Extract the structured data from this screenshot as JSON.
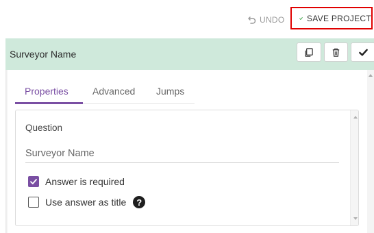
{
  "toolbar": {
    "undo_label": "UNDO",
    "save_label": "SAVE PROJECT",
    "save_highlight_color": "#e00000",
    "save_icon_color": "#2e9e3a"
  },
  "header": {
    "title": "Surveyor Name",
    "background_color": "#cfe9db",
    "actions": [
      "copy-icon",
      "trash-icon",
      "checkmark-icon"
    ]
  },
  "tabs": [
    {
      "label": "Properties",
      "active": true
    },
    {
      "label": "Advanced",
      "active": false
    },
    {
      "label": "Jumps",
      "active": false
    }
  ],
  "accent_color": "#7a4fa3",
  "question": {
    "label": "Question",
    "value": "Surveyor Name"
  },
  "options": [
    {
      "label": "Answer is required",
      "checked": true
    },
    {
      "label": "Use answer as title",
      "checked": false,
      "has_help": true
    }
  ]
}
